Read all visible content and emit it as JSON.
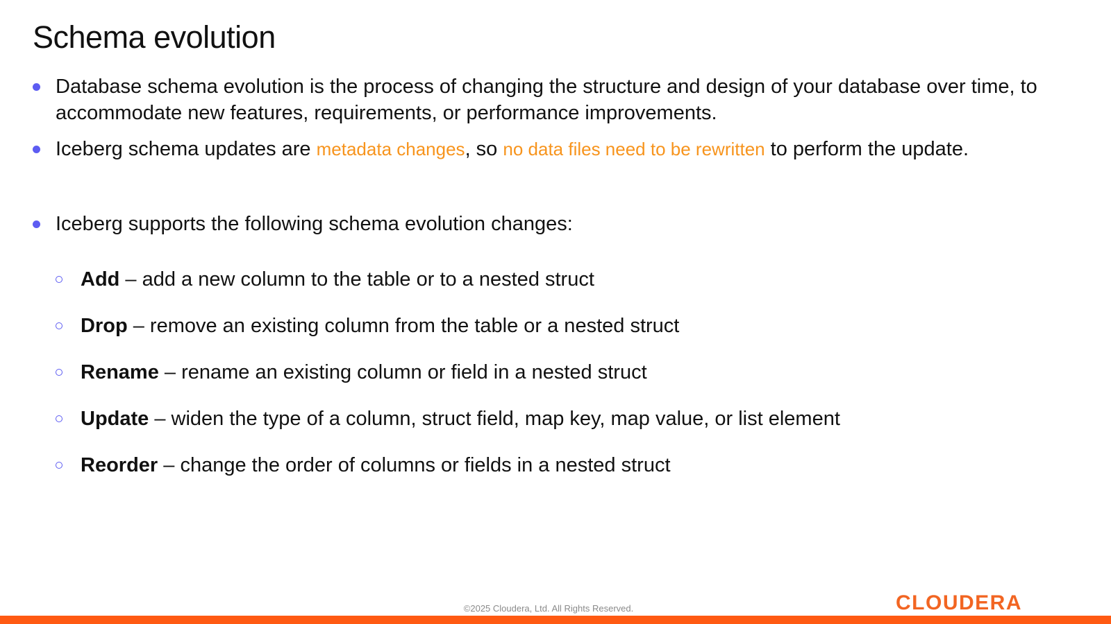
{
  "title": "Schema evolution",
  "bullets": {
    "b1": "Database schema evolution is the process of changing the structure and design of your database over time, to accommodate new features, requirements, or performance improvements.",
    "b2": {
      "part1": "Iceberg schema updates are ",
      "hl1": "metadata changes",
      "part2": ", so ",
      "hl2": "no data files need to be rewritten",
      "part3": " to perform the update."
    },
    "b3": "Iceberg supports the following schema evolution changes:"
  },
  "changes": [
    {
      "term": "Add",
      "desc": " – add a new column to the table or to a nested struct"
    },
    {
      "term": "Drop",
      "desc": " – remove an existing column from the table or a nested struct"
    },
    {
      "term": "Rename",
      "desc": " – rename an existing column or field in a nested struct"
    },
    {
      "term": "Update",
      "desc": " – widen the type of a column, struct field, map key, map value, or list element"
    },
    {
      "term": "Reorder",
      "desc": " – change the order of columns or fields in a nested struct"
    }
  ],
  "footer": {
    "copyright": "©2025 Cloudera, Ltd. All Rights Reserved.",
    "logo_text": "CLOUDERA"
  },
  "colors": {
    "accent_orange": "#f7941d",
    "bullet_blue": "#5d5cf2",
    "brand_bar": "#ff5a12",
    "logo": "#f26522"
  }
}
